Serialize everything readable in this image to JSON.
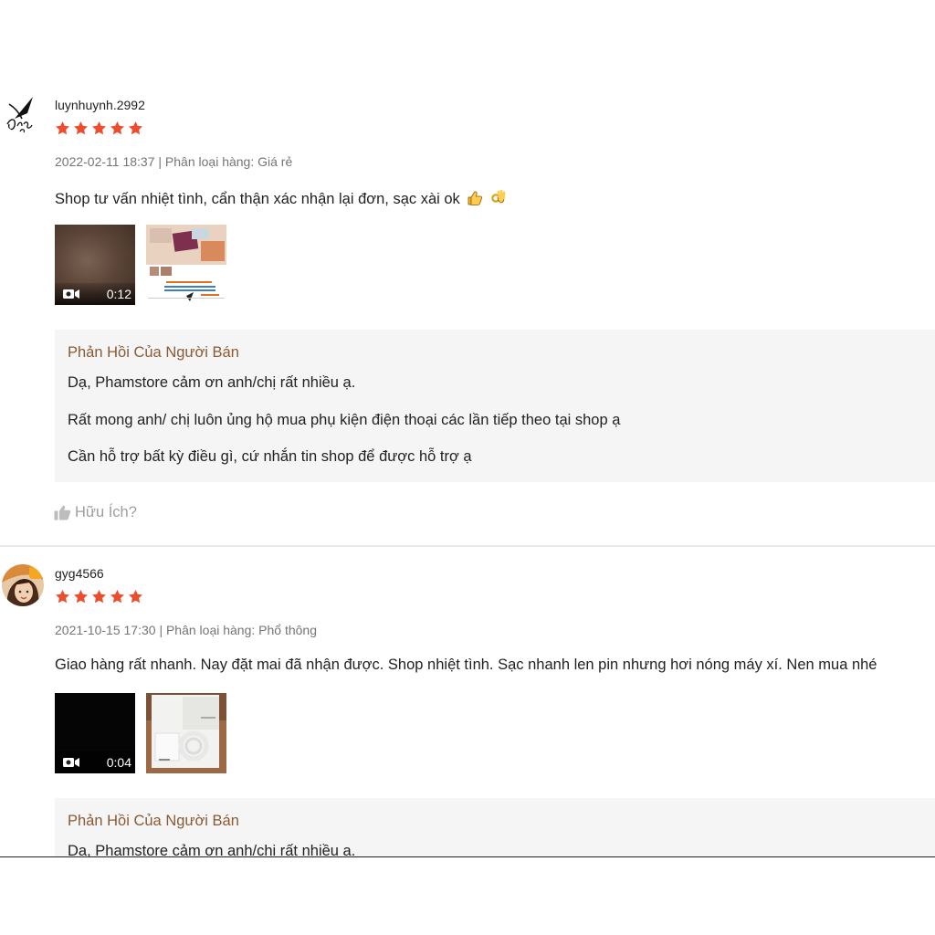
{
  "reviews": [
    {
      "username": "luynhuynh.2992",
      "rating": 5,
      "date": "2022-02-11 18:37",
      "separator": "|",
      "variant_label": "Phân loại hàng: Giá rẻ",
      "comment": "Shop tư vấn nhiệt tình, cẩn thận xác nhận lại đơn, sạc xài ok",
      "comment_emojis": [
        "👍",
        "👌"
      ],
      "media": {
        "video_duration": "0:12"
      },
      "seller_reply": {
        "title": "Phản Hồi Của Người Bán",
        "lines": [
          "Dạ, Phamstore cảm ơn anh/chị rất nhiều ạ.",
          "Rất mong anh/ chị luôn ủng hộ mua phụ kiện điện thoại các lần tiếp theo tại shop ạ",
          "Cần hỗ trợ bất kỳ điều gì, cứ nhắn tin shop để được hỗ trợ ạ"
        ]
      },
      "helpful_label": "Hữu Ích?",
      "icons": [
        "signature-avatar-icon",
        "star-icon",
        "video-camera-icon",
        "thumbs-up-icon"
      ]
    },
    {
      "username": "gyg4566",
      "rating": 5,
      "date": "2021-10-15 17:30",
      "separator": "|",
      "variant_label": "Phân loại hàng: Phổ thông",
      "comment": "Giao hàng rất nhanh. Nay đặt mai đã nhận được. Shop nhiệt tình. Sạc nhanh len pin nhưng hơi nóng máy xí. Nen mua nhé",
      "media": {
        "video_duration": "0:04"
      },
      "seller_reply": {
        "title": "Phản Hồi Của Người Bán",
        "lines": [
          "Dạ, Phamstore cảm ơn anh/chị rất nhiều ạ."
        ]
      }
    }
  ],
  "colors": {
    "star": "#ee4d2d",
    "reply_title": "#8a5a34",
    "reply_bg": "#f5f5f5",
    "meta_text": "#757575",
    "helpful_text": "#9e9e9e"
  }
}
